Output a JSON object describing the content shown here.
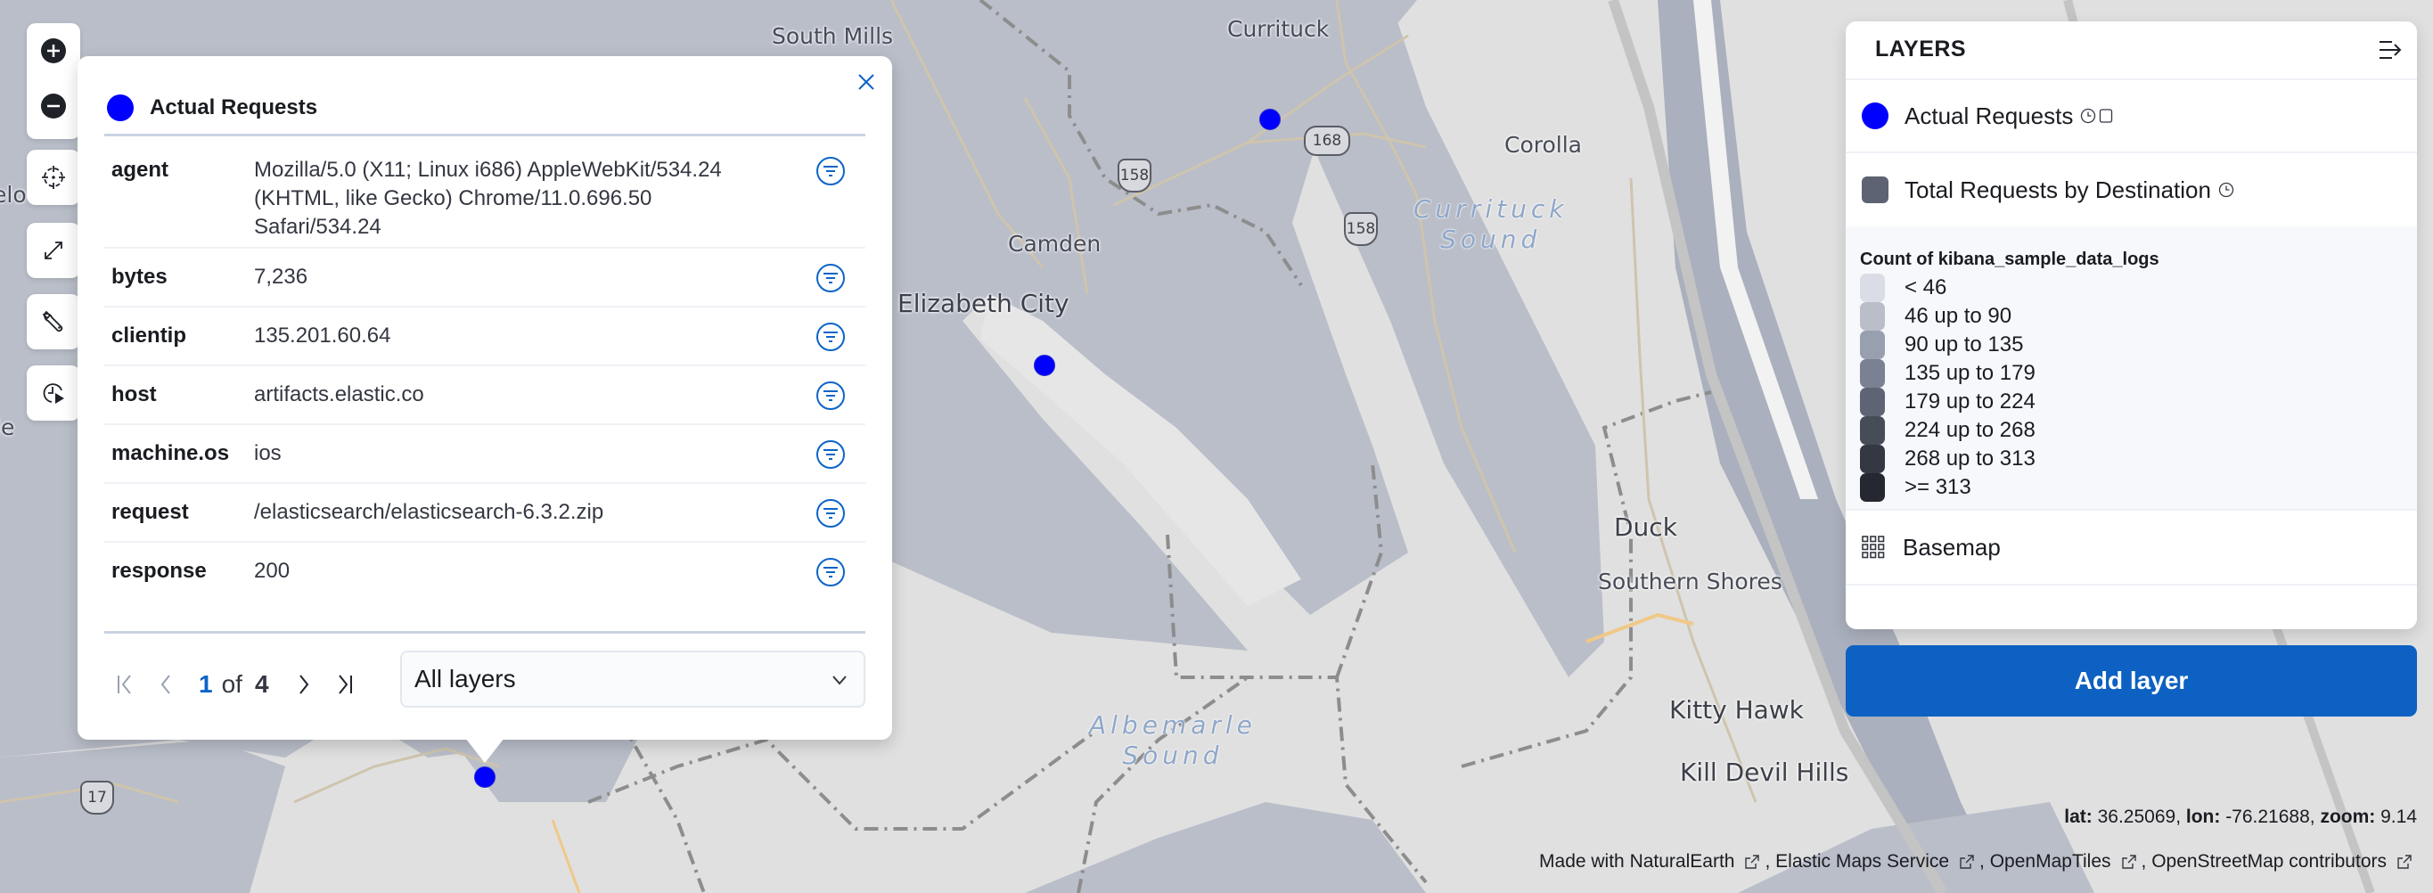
{
  "map": {
    "place_labels": [
      {
        "id": "south-mills",
        "text": "South Mills"
      },
      {
        "id": "currituck",
        "text": "Currituck"
      },
      {
        "id": "corolla",
        "text": "Corolla"
      },
      {
        "id": "camden",
        "text": "Camden"
      },
      {
        "id": "elizabeth-city",
        "text": "Elizabeth City"
      },
      {
        "id": "duck",
        "text": "Duck"
      },
      {
        "id": "southern-shores",
        "text": "Southern Shores"
      },
      {
        "id": "kitty-hawk",
        "text": "Kitty Hawk"
      },
      {
        "id": "kill-devil-hills",
        "text": "Kill Devil Hills"
      },
      {
        "id": "partial-left-1",
        "text": "elo"
      },
      {
        "id": "partial-left-2",
        "text": "le"
      }
    ],
    "water_labels": [
      {
        "id": "currituck-sound",
        "text": "Currituck\nSound"
      },
      {
        "id": "albemarle-sound",
        "text": "Albemarle\nSound"
      }
    ],
    "road_shields": [
      {
        "id": "us-158-a",
        "text": "158"
      },
      {
        "id": "us-158-b",
        "text": "158"
      },
      {
        "id": "nc-168",
        "text": "168"
      },
      {
        "id": "us-17",
        "text": "17"
      }
    ],
    "point_color": "#0000ff"
  },
  "toolbar": {
    "zoom_in": "zoom-in",
    "zoom_out": "zoom-out",
    "set_view": "set-view",
    "fit_to_data": "fit-to-data",
    "tools": "tools",
    "timeslider": "timeslider"
  },
  "popup": {
    "title": "Actual Requests",
    "layer_color": "#0000ff",
    "properties": [
      {
        "key": "agent",
        "value": "Mozilla/5.0 (X11; Linux i686) AppleWebKit/534.24 (KHTML, like Gecko) Chrome/11.0.696.50 Safari/534.24"
      },
      {
        "key": "bytes",
        "value": "7,236"
      },
      {
        "key": "clientip",
        "value": "135.201.60.64"
      },
      {
        "key": "host",
        "value": "artifacts.elastic.co"
      },
      {
        "key": "machine.os",
        "value": "ios"
      },
      {
        "key": "request",
        "value": "/elasticsearch/elasticsearch-6.3.2.zip"
      },
      {
        "key": "response",
        "value": "200"
      }
    ],
    "pagination": {
      "current": "1",
      "of_label": "of",
      "total": "4"
    },
    "layer_select": {
      "selected": "All layers"
    }
  },
  "layers_panel": {
    "title": "LAYERS",
    "layers": [
      {
        "name": "Actual Requests",
        "color": "#0000ff"
      },
      {
        "name": "Total Requests by Destination",
        "color": "#5e6373"
      }
    ],
    "legend": {
      "title": "Count of kibana_sample_data_logs",
      "items": [
        {
          "label": "< 46",
          "color": "#dadde5"
        },
        {
          "label": "46 up to 90",
          "color": "#b9bec9"
        },
        {
          "label": "90 up to 135",
          "color": "#989fae"
        },
        {
          "label": "135 up to 179",
          "color": "#7a8193"
        },
        {
          "label": "179 up to 224",
          "color": "#5e6474"
        },
        {
          "label": "224 up to 268",
          "color": "#474c59"
        },
        {
          "label": "268 up to 313",
          "color": "#343843"
        },
        {
          "label": ">= 313",
          "color": "#252830"
        }
      ]
    },
    "basemap": "Basemap",
    "add_layer": "Add layer"
  },
  "status": {
    "lat_label": "lat:",
    "lat": "36.25069",
    "lon_label": "lon:",
    "lon": "-76.21688",
    "zoom_label": "zoom:",
    "zoom": "9.14"
  },
  "attribution": [
    {
      "text": "Made with NaturalEarth"
    },
    {
      "text": "Elastic Maps Service"
    },
    {
      "text": "OpenMapTiles"
    },
    {
      "text": "OpenStreetMap contributors"
    }
  ],
  "colors": {
    "accent": "#0d61c2",
    "link": "#0b64c8",
    "choropleth_fill": "#b9bec9",
    "water": "#e0e0e0"
  }
}
